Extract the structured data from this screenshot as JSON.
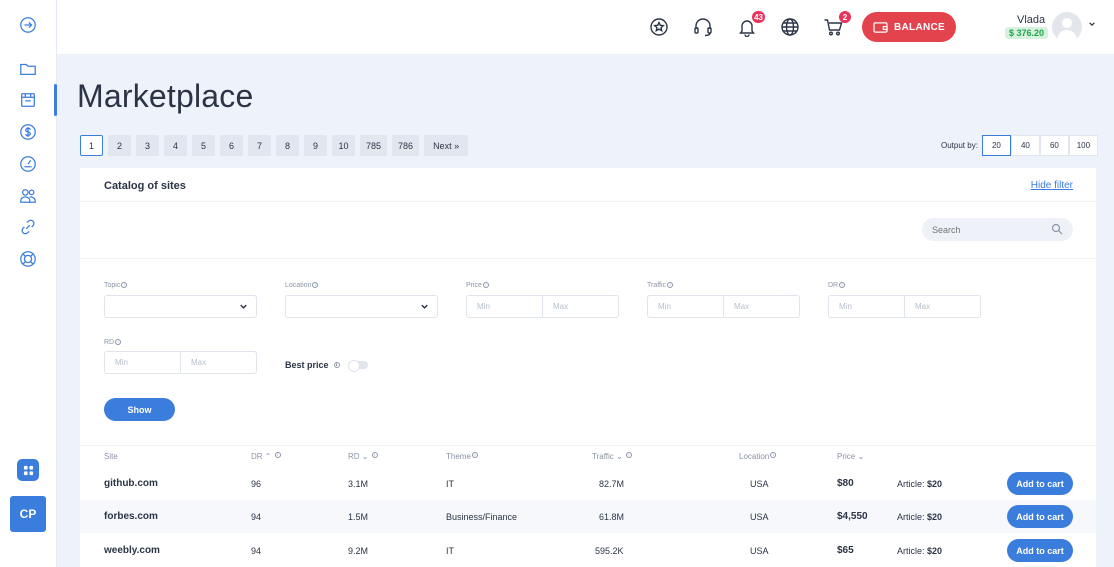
{
  "sidebar": {
    "items": [
      {
        "icon": "collapse-arrow-icon"
      },
      {
        "icon": "folder-icon"
      },
      {
        "icon": "store-icon",
        "active": true
      },
      {
        "icon": "dollar-icon"
      },
      {
        "icon": "gauge-icon"
      },
      {
        "icon": "users-icon"
      },
      {
        "icon": "link-icon"
      },
      {
        "icon": "lifebuoy-icon"
      }
    ],
    "grid_icon": "apps-grid-icon",
    "cp_label": "CP"
  },
  "header": {
    "notifications_count": "43",
    "cart_count": "2",
    "balance_label": "BALANCE",
    "user_name": "Vlada",
    "user_balance": "$ 376.20"
  },
  "page_title": "Marketplace",
  "pagination": {
    "pages": [
      "1",
      "2",
      "3",
      "4",
      "5",
      "6",
      "7",
      "8",
      "9",
      "10",
      "785",
      "786",
      "Next »"
    ],
    "active": "1"
  },
  "output": {
    "label": "Output by:",
    "options": [
      "20",
      "40",
      "60",
      "100"
    ],
    "active": "20"
  },
  "catalog": {
    "title": "Catalog of sites",
    "hide_filter": "Hide filter",
    "search_placeholder": "Search"
  },
  "filters": {
    "topic": "Topic",
    "location": "Location",
    "price": "Price",
    "traffic": "Traffic",
    "dr": "DR",
    "rd": "RD",
    "min": "Min",
    "max": "Max",
    "best_price": "Best price",
    "show": "Show"
  },
  "table": {
    "headers": {
      "site": "Site",
      "dr": "DR",
      "rd": "RD",
      "theme": "Theme",
      "traffic": "Traffic",
      "location": "Location",
      "price": "Price"
    },
    "article_label": "Article:",
    "add_to_cart": "Add to cart",
    "rows": [
      {
        "site": "github.com",
        "dr": "96",
        "rd": "3.1M",
        "theme": "IT",
        "traffic": "82.7M",
        "location": "USA",
        "price": "$80",
        "article": "$20"
      },
      {
        "site": "forbes.com",
        "dr": "94",
        "rd": "1.5M",
        "theme": "Business/Finance",
        "traffic": "61.8M",
        "location": "USA",
        "price": "$4,550",
        "article": "$20"
      },
      {
        "site": "weebly.com",
        "dr": "94",
        "rd": "9.2M",
        "theme": "IT",
        "traffic": "595.2K",
        "location": "USA",
        "price": "$65",
        "article": "$20"
      }
    ]
  },
  "colors": {
    "accent": "#3b7ddd",
    "balance": "#e3434d",
    "badge": "#e8335b",
    "money": "#23a24d"
  }
}
